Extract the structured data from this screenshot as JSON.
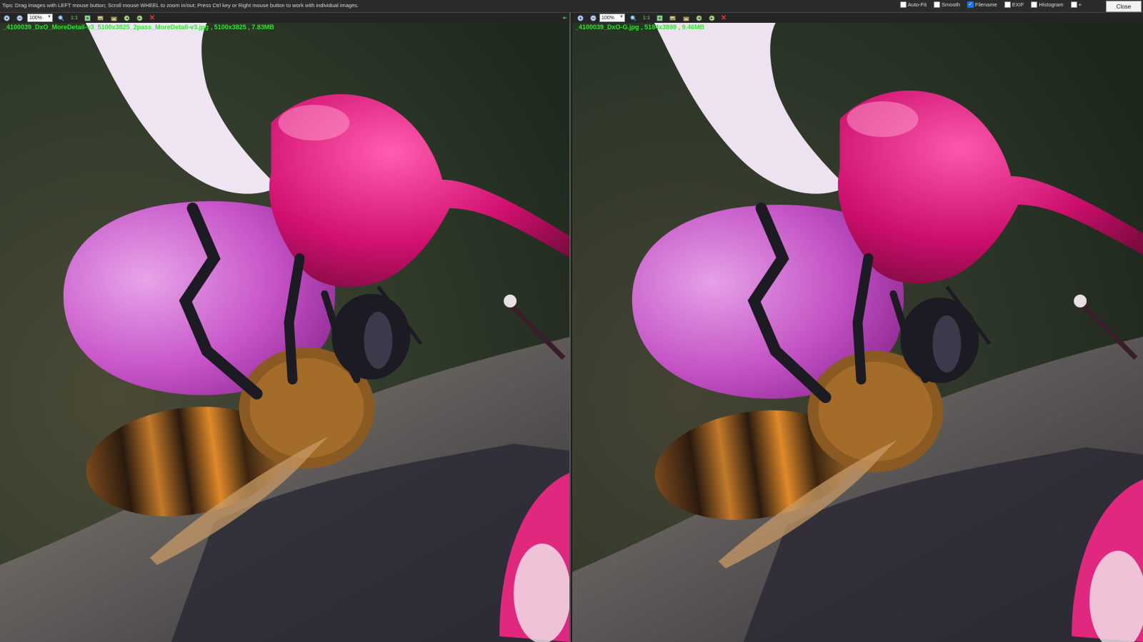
{
  "tips": "Tips: Drag images with LEFT mouse button; Scroll mouse WHEEL to zoom in/out; Press Ctrl key or Right mouse button to work with individual images.",
  "options": [
    {
      "label": "Auto-Fit",
      "checked": false
    },
    {
      "label": "Smooth",
      "checked": false
    },
    {
      "label": "Filename",
      "checked": true
    },
    {
      "label": "EXIF",
      "checked": false
    },
    {
      "label": "Histogram",
      "checked": false
    },
    {
      "label": "+",
      "checked": false
    }
  ],
  "close_label": "Close",
  "left_pane": {
    "zoom": "100%",
    "one_to_one": "1:1",
    "filename": "_4100039_DxO_MoreDetail-v3_5100x3825_2pass_MoreDetail-v3.jpg",
    "dimensions": "5100x3825",
    "filesize": "7.83MB"
  },
  "right_pane": {
    "zoom": "100%",
    "one_to_one": "1:1",
    "filename": "_4100039_DxO-G.jpg",
    "dimensions": "5184x3888",
    "filesize": "9.46MB"
  },
  "colors": {
    "accent_checkbox": "#1a73e8",
    "filename_text": "#2ee82e",
    "close_icon": "#e53935"
  },
  "icons": [
    "zoom-in-icon",
    "zoom-out-icon",
    "zoom-select-icon",
    "fit-icon",
    "fit-screen-icon",
    "rotate-left-icon",
    "rotate-right-icon",
    "sync-icon",
    "save-icon",
    "close-image-icon"
  ]
}
